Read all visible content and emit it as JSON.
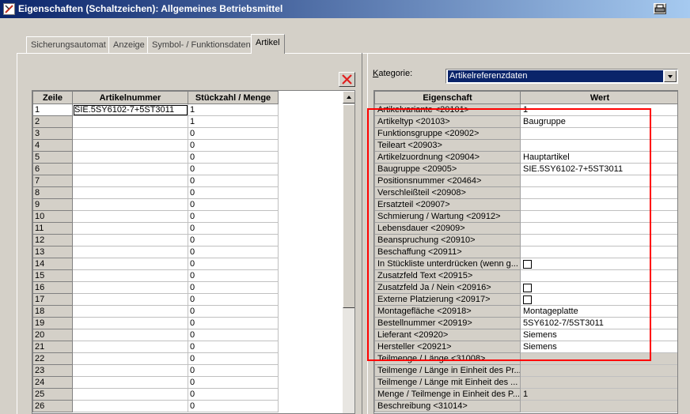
{
  "window": {
    "title": "Eigenschaften (Schaltzeichen): Allgemeines Betriebsmittel"
  },
  "tabs": [
    {
      "label": "Sicherungsautomat",
      "active": false
    },
    {
      "label": "Anzeige",
      "active": false
    },
    {
      "label": "Symbol- / Funktionsdaten",
      "active": false
    },
    {
      "label": "Artikel",
      "active": true
    }
  ],
  "article_grid": {
    "columns": [
      "Zeile",
      "Artikelnummer",
      "Stückzahl / Menge"
    ],
    "rows": [
      {
        "row": "1",
        "article": "SIE.5SY6102-7+5ST3011",
        "qty": "1"
      },
      {
        "row": "2",
        "article": "",
        "qty": "1"
      },
      {
        "row": "3",
        "article": "",
        "qty": "0"
      },
      {
        "row": "4",
        "article": "",
        "qty": "0"
      },
      {
        "row": "5",
        "article": "",
        "qty": "0"
      },
      {
        "row": "6",
        "article": "",
        "qty": "0"
      },
      {
        "row": "7",
        "article": "",
        "qty": "0"
      },
      {
        "row": "8",
        "article": "",
        "qty": "0"
      },
      {
        "row": "9",
        "article": "",
        "qty": "0"
      },
      {
        "row": "10",
        "article": "",
        "qty": "0"
      },
      {
        "row": "11",
        "article": "",
        "qty": "0"
      },
      {
        "row": "12",
        "article": "",
        "qty": "0"
      },
      {
        "row": "13",
        "article": "",
        "qty": "0"
      },
      {
        "row": "14",
        "article": "",
        "qty": "0"
      },
      {
        "row": "15",
        "article": "",
        "qty": "0"
      },
      {
        "row": "16",
        "article": "",
        "qty": "0"
      },
      {
        "row": "17",
        "article": "",
        "qty": "0"
      },
      {
        "row": "18",
        "article": "",
        "qty": "0"
      },
      {
        "row": "19",
        "article": "",
        "qty": "0"
      },
      {
        "row": "20",
        "article": "",
        "qty": "0"
      },
      {
        "row": "21",
        "article": "",
        "qty": "0"
      },
      {
        "row": "22",
        "article": "",
        "qty": "0"
      },
      {
        "row": "23",
        "article": "",
        "qty": "0"
      },
      {
        "row": "24",
        "article": "",
        "qty": "0"
      },
      {
        "row": "25",
        "article": "",
        "qty": "0"
      },
      {
        "row": "26",
        "article": "",
        "qty": "0"
      }
    ]
  },
  "kategorie": {
    "label_prefix": "K",
    "label_rest": "ategorie:",
    "value": "Artikelreferenzdaten"
  },
  "properties_grid": {
    "columns": [
      "Eigenschaft",
      "Wert"
    ],
    "rows": [
      {
        "prop": "Artikelvariante <20101>",
        "value": "1",
        "type": "text",
        "readonly": false
      },
      {
        "prop": "Artikeltyp <20103>",
        "value": "Baugruppe",
        "type": "text",
        "readonly": false
      },
      {
        "prop": "Funktionsgruppe <20902>",
        "value": "",
        "type": "text",
        "readonly": false
      },
      {
        "prop": "Teileart <20903>",
        "value": "",
        "type": "text",
        "readonly": false
      },
      {
        "prop": "Artikelzuordnung <20904>",
        "value": "Hauptartikel",
        "type": "text",
        "readonly": false
      },
      {
        "prop": "Baugruppe <20905>",
        "value": "SIE.5SY6102-7+5ST3011",
        "type": "text",
        "readonly": false
      },
      {
        "prop": "Positionsnummer <20464>",
        "value": "",
        "type": "text",
        "readonly": false
      },
      {
        "prop": "Verschleißteil <20908>",
        "value": "",
        "type": "text",
        "readonly": false
      },
      {
        "prop": "Ersatzteil <20907>",
        "value": "",
        "type": "text",
        "readonly": false
      },
      {
        "prop": "Schmierung / Wartung <20912>",
        "value": "",
        "type": "text",
        "readonly": false
      },
      {
        "prop": "Lebensdauer <20909>",
        "value": "",
        "type": "text",
        "readonly": false
      },
      {
        "prop": "Beanspruchung <20910>",
        "value": "",
        "type": "text",
        "readonly": false
      },
      {
        "prop": "Beschaffung <20911>",
        "value": "",
        "type": "text",
        "readonly": false
      },
      {
        "prop": "In Stückliste unterdrücken (wenn g...",
        "value": "",
        "type": "checkbox",
        "readonly": false
      },
      {
        "prop": "Zusatzfeld Text <20915>",
        "value": "",
        "type": "text",
        "readonly": false
      },
      {
        "prop": "Zusatzfeld Ja / Nein  <20916>",
        "value": "",
        "type": "checkbox",
        "readonly": false
      },
      {
        "prop": "Externe Platzierung <20917>",
        "value": "",
        "type": "checkbox",
        "readonly": false
      },
      {
        "prop": "Montagefläche <20918>",
        "value": "Montageplatte",
        "type": "text",
        "readonly": false
      },
      {
        "prop": "Bestellnummer <20919>",
        "value": "5SY6102-7/5ST3011",
        "type": "text",
        "readonly": false
      },
      {
        "prop": "Lieferant <20920>",
        "value": "Siemens",
        "type": "text",
        "readonly": false
      },
      {
        "prop": "Hersteller <20921>",
        "value": "Siemens",
        "type": "text",
        "readonly": false
      },
      {
        "prop": "Teilmenge / Länge <31008>",
        "value": "",
        "type": "text",
        "readonly": true
      },
      {
        "prop": "Teilmenge / Länge in Einheit des Pr...",
        "value": "",
        "type": "text",
        "readonly": true
      },
      {
        "prop": "Teilmenge / Länge mit Einheit des ...",
        "value": "",
        "type": "text",
        "readonly": true
      },
      {
        "prop": "Menge / Teilmenge in Einheit des P...",
        "value": "1",
        "type": "text",
        "readonly": true
      },
      {
        "prop": "Beschreibung <31014>",
        "value": "",
        "type": "text",
        "readonly": true
      }
    ]
  },
  "colors": {
    "highlight": "#ff0000",
    "titlebar_start": "#0a246a",
    "titlebar_end": "#a6caf0",
    "selection": "#0a246a"
  },
  "icons": {
    "app": "app-icon",
    "print": "print-icon",
    "delete": "delete-x-icon",
    "dropdown": "chevron-down-icon"
  }
}
